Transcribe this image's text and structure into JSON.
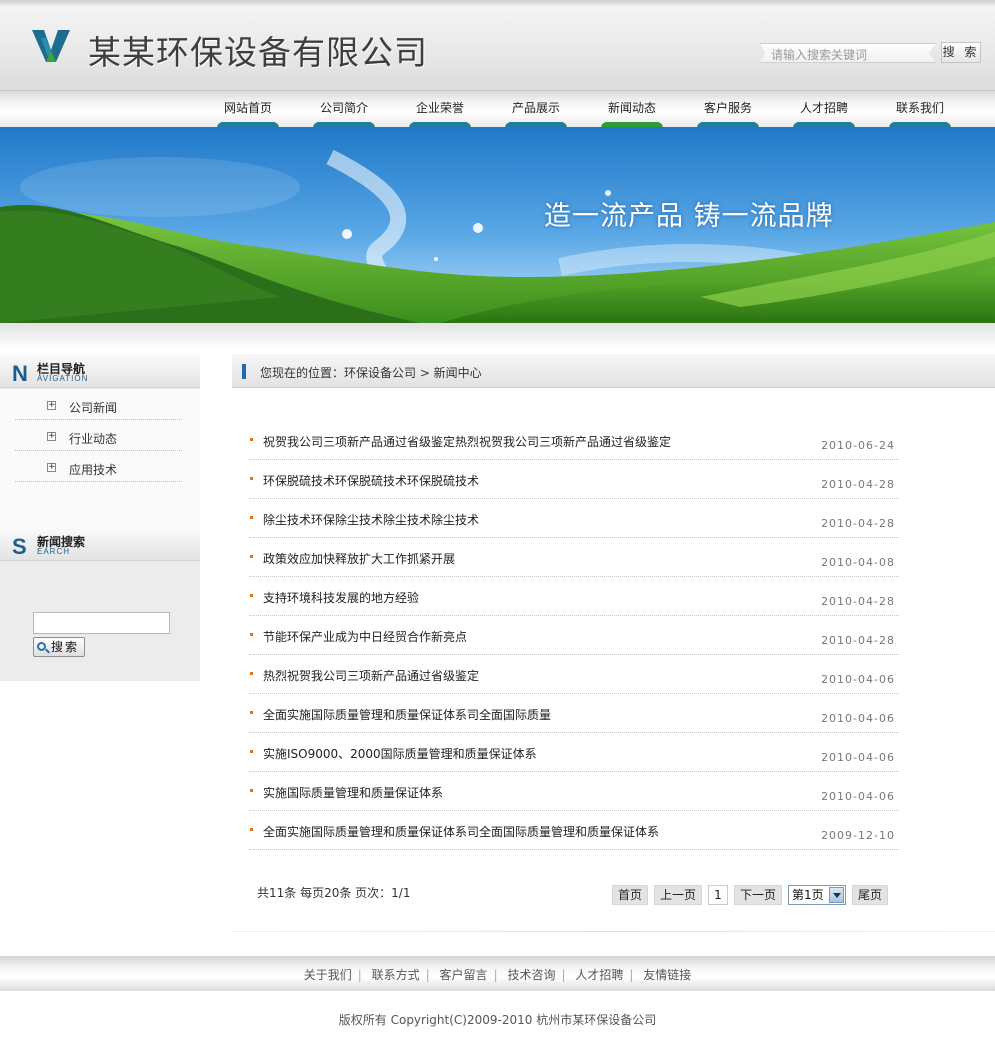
{
  "header": {
    "company_name": "某某环保设备有限公司",
    "search_placeholder": "请输入搜索关键词",
    "search_button": "搜 索"
  },
  "nav": {
    "items": [
      "网站首页",
      "公司简介",
      "企业荣誉",
      "产品展示",
      "新闻动态",
      "客户服务",
      "人才招聘",
      "联系我们"
    ],
    "active_index": 4
  },
  "banner": {
    "slogan": "造一流产品 铸一流品牌"
  },
  "sidebar": {
    "nav_title": "栏目导航",
    "nav_subtitle": "AVIGATION",
    "nav_letter": "N",
    "items": [
      {
        "label": "公司新闻"
      },
      {
        "label": "行业动态"
      },
      {
        "label": "应用技术"
      }
    ],
    "search_title": "新闻搜索",
    "search_subtitle": "EARCH",
    "search_letter": "S",
    "search_button": "搜索"
  },
  "location": {
    "text": "您现在的位置：环保设备公司 > 新闻中心"
  },
  "news": [
    {
      "title": "祝贺我公司三项新产品通过省级鉴定热烈祝贺我公司三项新产品通过省级鉴定",
      "date": "2010-06-24"
    },
    {
      "title": "环保脱硫技术环保脱硫技术环保脱硫技术",
      "date": "2010-04-28"
    },
    {
      "title": "除尘技术环保除尘技术除尘技术除尘技术",
      "date": "2010-04-28"
    },
    {
      "title": "政策效应加快释放扩大工作抓紧开展",
      "date": "2010-04-08"
    },
    {
      "title": "支持环境科技发展的地方经验",
      "date": "2010-04-28"
    },
    {
      "title": "节能环保产业成为中日经贸合作新亮点",
      "date": "2010-04-28"
    },
    {
      "title": "热烈祝贺我公司三项新产品通过省级鉴定",
      "date": "2010-04-06"
    },
    {
      "title": "全面实施国际质量管理和质量保证体系司全面国际质量",
      "date": "2010-04-06"
    },
    {
      "title": "实施ISO9000、2000国际质量管理和质量保证体系",
      "date": "2010-04-06"
    },
    {
      "title": "实施国际质量管理和质量保证体系",
      "date": "2010-04-06"
    },
    {
      "title": "全面实施国际质量管理和质量保证体系司全面国际质量管理和质量保证体系",
      "date": "2009-12-10"
    }
  ],
  "pager": {
    "info": "共11条  每页20条  页次：1/1",
    "first": "首页",
    "prev": "上一页",
    "current": "1",
    "next": "下一页",
    "select": "第1页",
    "last": "尾页"
  },
  "footer": {
    "links": [
      "关于我们",
      "联系方式",
      "客户留言",
      "技术咨询",
      "人才招聘",
      "友情链接"
    ],
    "separator": "|",
    "copyright": "版权所有  Copyright(C)2009-2010 杭州市某环保设备公司"
  },
  "colors": {
    "accent_blue": "#1f7d9f",
    "active_green": "#2f9a39",
    "bullet_orange": "#e0741a"
  }
}
